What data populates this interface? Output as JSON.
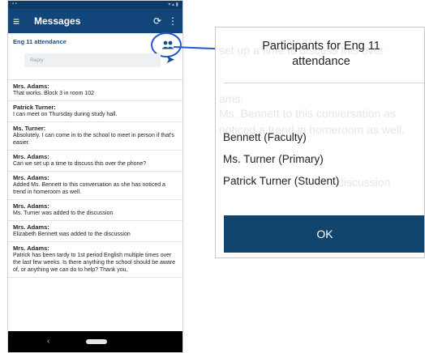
{
  "phone": {
    "appbar": {
      "title": "Messages"
    },
    "conversation": {
      "title": "Eng 11 attendance",
      "reply_placeholder": "Reply"
    },
    "messages": [
      {
        "sender": "Mrs. Adams:",
        "text": "That works. Block 3 in room 102"
      },
      {
        "sender": "Patrick Turner:",
        "text": "I can meet on Thursday during study hall."
      },
      {
        "sender": "Ms. Turner:",
        "text": "Absolutely. I can come in to the school to meet in person if that's easier."
      },
      {
        "sender": "Mrs. Adams:",
        "text": "Can we set up a time to discuss this over the phone?"
      },
      {
        "sender": "Mrs. Adams:",
        "text": "Added Ms. Bennett to this conversation as she has noticed a trend in homeroom as well."
      },
      {
        "sender": "Mrs. Adams:",
        "text": "Ms. Turner was added to the discussion"
      },
      {
        "sender": "Mrs. Adams:",
        "text": "Elizabeth Bennett was added to the discussion"
      },
      {
        "sender": "Mrs. Adams:",
        "text": "Patrick has been tardy to 1st period English multiple times over the last few weeks. Is there anything the school should be aware of, or anything we can do to help? Thank you,"
      }
    ]
  },
  "dialog": {
    "title": "Participants for Eng 11 attendance",
    "participants": [
      "Bennett (Faculty)",
      "Ms. Turner (Primary)",
      "Patrick Turner (Student)"
    ],
    "ok_label": "OK"
  },
  "colors": {
    "appbar": "#12467a",
    "accent": "#1a4f86",
    "ok_button": "#11456e",
    "highlight": "#1e5bd0"
  },
  "icons": [
    "menu-icon",
    "refresh-icon",
    "more-vert-icon",
    "people-icon",
    "send-icon",
    "back-icon"
  ]
}
